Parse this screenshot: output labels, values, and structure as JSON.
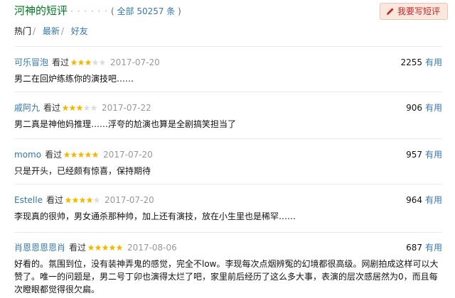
{
  "header": {
    "title": "河神的短评",
    "dots": "· · · · · ·",
    "count_open": "(",
    "count_label": "全部 50257 条",
    "count_close": ")",
    "write_button": "我要写短评",
    "accent_color": "#007722",
    "link_color": "#3377aa"
  },
  "tabs": [
    {
      "label": "热门",
      "sep": "/",
      "active": true
    },
    {
      "label": "最新",
      "sep": "/",
      "active": false
    },
    {
      "label": "好友",
      "sep": "",
      "active": false
    }
  ],
  "comments": [
    {
      "user": "可乐冒泡",
      "status": "看过",
      "rating": 3,
      "date": "2017-07-20",
      "votes": "2255",
      "useful": "有用",
      "text": "男二在回炉练练你的演技吧……"
    },
    {
      "user": "戚阿九",
      "status": "看过",
      "rating": 3,
      "date": "2017-07-22",
      "votes": "906",
      "useful": "有用",
      "text": "男二真是神他妈推理……浮夸的尬演也算是全剧搞笑担当了"
    },
    {
      "user": "momo",
      "status": "看过",
      "rating": 5,
      "date": "2017-07-20",
      "votes": "957",
      "useful": "有用",
      "text": "只是开头，已经颇有惊喜，保持期待"
    },
    {
      "user": "Estelle",
      "status": "看过",
      "rating": 4,
      "date": "2017-07-20",
      "votes": "964",
      "useful": "有用",
      "text": "李现真的很帅，男女通杀那种帅，加上还有演技，放在小生里也是稀罕……"
    },
    {
      "user": "肖恩恩恩恩肖",
      "status": "看过",
      "rating": 5,
      "date": "2017-08-06",
      "votes": "687",
      "useful": "有用",
      "text": "好看的。氛围到位，没有装神弄鬼的感觉，完全不low。李现每次点烟辨冤的幻境都很高级。网剧拍成这样可以大赞了。唯一的问题是，男二号丁卯也演得太烂了吧，家里前后经历了这么多大事，表演的层次感居然为0，而且每次瞪眼都觉得很欠扁。"
    }
  ],
  "colors": {
    "star_on": "#f5b800",
    "star_off": "#dddddd",
    "button_bg": "#fae7dd",
    "button_text": "#c3282a"
  }
}
